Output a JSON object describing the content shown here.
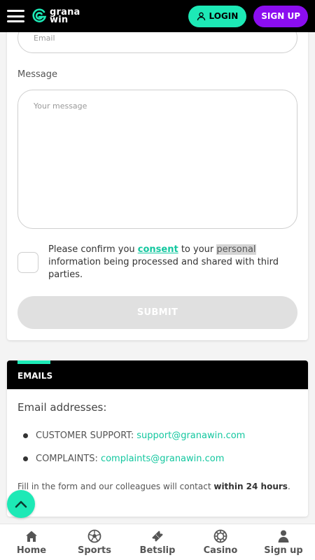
{
  "header": {
    "logo_line1": "grana",
    "logo_line2": "win",
    "login_label": "LOGIN",
    "signup_label": "SIGN UP"
  },
  "form": {
    "email_placeholder": "Email",
    "message_label": "Message",
    "message_placeholder": "Your message",
    "consent_before": "Please confirm you ",
    "consent_link": "consent",
    "consent_middle": " to your ",
    "consent_highlight": "personal",
    "consent_after": " information being processed and shared with third parties.",
    "submit_label": "SUBMIT"
  },
  "emails": {
    "title": "EMAILS",
    "subtitle": "Email addresses:",
    "items": [
      {
        "label": "CUSTOMER SUPPORT:",
        "email": "support@granawin.com"
      },
      {
        "label": "COMPLAINTS:",
        "email": "complaints@granawin.com"
      }
    ],
    "note_before": "Fill in the form and our colleagues will contact ",
    "note_bold": "within 24 hours",
    "note_after": "."
  },
  "nav": {
    "items": [
      {
        "label": "Home",
        "icon": "home-icon"
      },
      {
        "label": "Sports",
        "icon": "soccer-ball-icon"
      },
      {
        "label": "Betslip",
        "icon": "ticket-icon"
      },
      {
        "label": "Casino",
        "icon": "casino-chip-icon"
      },
      {
        "label": "Sign up",
        "icon": "user-icon"
      }
    ]
  },
  "colors": {
    "accent": "#1de9b6",
    "signup": "#8b0df0",
    "header_bg": "#000000",
    "link": "#13c79f"
  }
}
